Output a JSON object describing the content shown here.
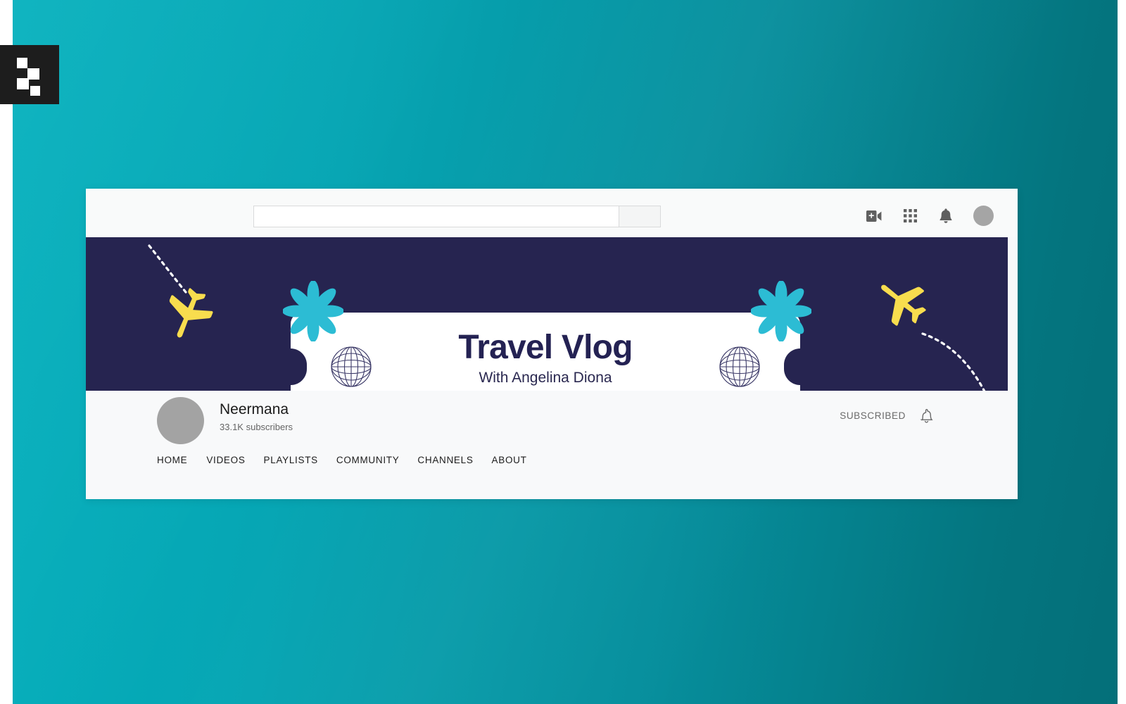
{
  "page": {
    "background_gradient_from": "#03b0bd",
    "background_gradient_to": "#046f79"
  },
  "logo_badge": {
    "name": "pixel-logo-mark",
    "background": "#1d1d1d",
    "mark_color": "#ffffff"
  },
  "browser_card": {
    "background": "#f8f9fa"
  },
  "topbar": {
    "search": {
      "value": "",
      "placeholder": ""
    },
    "search_button_label": "",
    "icons": [
      {
        "name": "create-video-icon",
        "label": "Create"
      },
      {
        "name": "apps-grid-icon",
        "label": "YouTube apps"
      },
      {
        "name": "notifications-bell-icon",
        "label": "Notifications"
      }
    ],
    "avatar_color": "#a5a5a5"
  },
  "banner": {
    "background": "#262450",
    "ticket": {
      "title": "Travel Vlog",
      "subtitle": "With Angelina Diona",
      "title_color": "#242253",
      "card_color": "#ffffff",
      "accent_dash_color": "#8fdfe8"
    },
    "decorations": [
      {
        "name": "airplane-left",
        "color": "#f8dd4e",
        "rotation_deg": 202
      },
      {
        "name": "airplane-right",
        "color": "#f8dd4e",
        "rotation_deg": -52
      },
      {
        "name": "flower-left",
        "color": "#2cbcd4"
      },
      {
        "name": "flower-right",
        "color": "#2cbcd4"
      },
      {
        "name": "globe-left",
        "color": "#3c3a68"
      },
      {
        "name": "globe-right",
        "color": "#3c3a68"
      },
      {
        "name": "flight-trail-left",
        "color": "#ffffff"
      },
      {
        "name": "flight-trail-right",
        "color": "#ffffff"
      }
    ]
  },
  "channel": {
    "name": "Neermana",
    "subscribers": "33.1K subscribers",
    "avatar_color": "#a3a3a3",
    "subscribe_label": "SUBSCRIBED",
    "notification_icon": "bell-outline-icon"
  },
  "nav_tabs": [
    {
      "label": "HOME",
      "active": true
    },
    {
      "label": "VIDEOS",
      "active": false
    },
    {
      "label": "PLAYLISTS",
      "active": false
    },
    {
      "label": "COMMUNITY",
      "active": false
    },
    {
      "label": "CHANNELS",
      "active": false
    },
    {
      "label": "ABOUT",
      "active": false
    }
  ]
}
